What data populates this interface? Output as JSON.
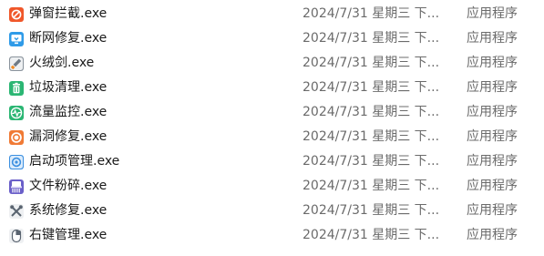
{
  "files": [
    {
      "name": "弹窗拦截.exe",
      "modified": "2024/7/31 星期三 下...",
      "type": "应用程序",
      "icon": "popup-block-icon",
      "icon_color": "#f0572a"
    },
    {
      "name": "断网修复.exe",
      "modified": "2024/7/31 星期三 下...",
      "type": "应用程序",
      "icon": "network-repair-icon",
      "icon_color": "#2f9be8"
    },
    {
      "name": "火绒剑.exe",
      "modified": "2024/7/31 星期三 下...",
      "type": "应用程序",
      "icon": "huorong-sword-icon",
      "icon_color": "#6f7a86"
    },
    {
      "name": "垃圾清理.exe",
      "modified": "2024/7/31 星期三 下...",
      "type": "应用程序",
      "icon": "trash-clean-icon",
      "icon_color": "#2bb673"
    },
    {
      "name": "流量监控.exe",
      "modified": "2024/7/31 星期三 下...",
      "type": "应用程序",
      "icon": "traffic-monitor-icon",
      "icon_color": "#2bb673"
    },
    {
      "name": "漏洞修复.exe",
      "modified": "2024/7/31 星期三 下...",
      "type": "应用程序",
      "icon": "vulnerability-repair-icon",
      "icon_color": "#f07a35"
    },
    {
      "name": "启动项管理.exe",
      "modified": "2024/7/31 星期三 下...",
      "type": "应用程序",
      "icon": "startup-manager-icon",
      "icon_color": "#3b8fe0"
    },
    {
      "name": "文件粉碎.exe",
      "modified": "2024/7/31 星期三 下...",
      "type": "应用程序",
      "icon": "file-shredder-icon",
      "icon_color": "#6a5fc9"
    },
    {
      "name": "系统修复.exe",
      "modified": "2024/7/31 星期三 下...",
      "type": "应用程序",
      "icon": "system-repair-icon",
      "icon_color": "#5a6470"
    },
    {
      "name": "右键管理.exe",
      "modified": "2024/7/31 星期三 下...",
      "type": "应用程序",
      "icon": "context-menu-manager-icon",
      "icon_color": "#5a6470"
    }
  ]
}
